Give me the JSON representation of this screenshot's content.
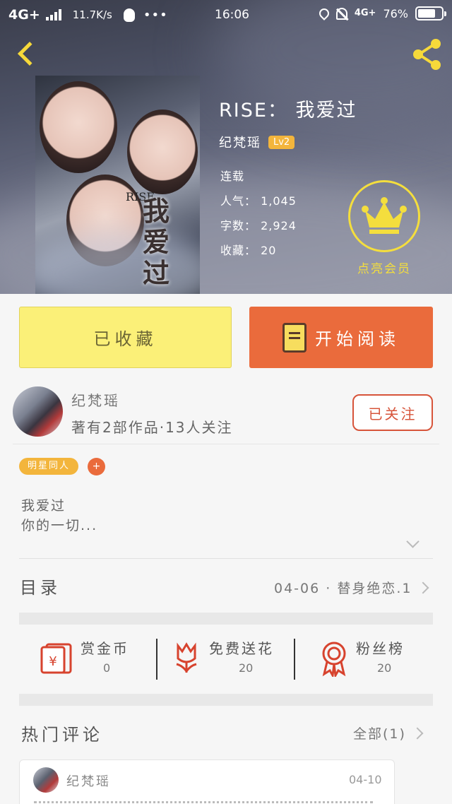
{
  "status_bar": {
    "network": "4G+",
    "speed": "11.7K/s",
    "dots": "•••",
    "time": "16:06",
    "signal_right": "4G+",
    "battery_pct": "76%",
    "battery_level": 0.76
  },
  "book": {
    "title": "RISE： 我爱过",
    "author": "纪梵瑶",
    "level": "Lv2",
    "status": "连载",
    "popularity": "人气： 1,045",
    "word_count": "字数： 2,924",
    "favorites": "收藏： 20",
    "cover_title": "我爱过",
    "cover_subtitle": "RISE"
  },
  "vip": {
    "label": "点亮会员"
  },
  "actions": {
    "favorited_label": "已收藏",
    "read_label": "开始阅读"
  },
  "author_panel": {
    "name": "纪梵瑶",
    "stats": "著有2部作品·13人关注",
    "follow_label": "已关注"
  },
  "tags": {
    "items": [
      "明星同人"
    ],
    "add_label": "+"
  },
  "description": {
    "line1": "我爱过",
    "line2": "你的一切..."
  },
  "catalog": {
    "label": "目录",
    "latest": "04-06 · 替身绝恋.1"
  },
  "stats": {
    "coins_label": "赏金币",
    "coins_value": "0",
    "flowers_label": "免费送花",
    "flowers_value": "20",
    "fans_label": "粉丝榜",
    "fans_value": "20"
  },
  "comments": {
    "label": "热门评论",
    "all_label": "全部(1)",
    "items": [
      {
        "name": "纪梵瑶",
        "date": "04-10"
      }
    ]
  },
  "colors": {
    "accent_orange": "#ea6b3c",
    "accent_yellow": "#fbf078",
    "tag_yellow": "#f3b53c",
    "vip_gold": "#f4de3d"
  }
}
